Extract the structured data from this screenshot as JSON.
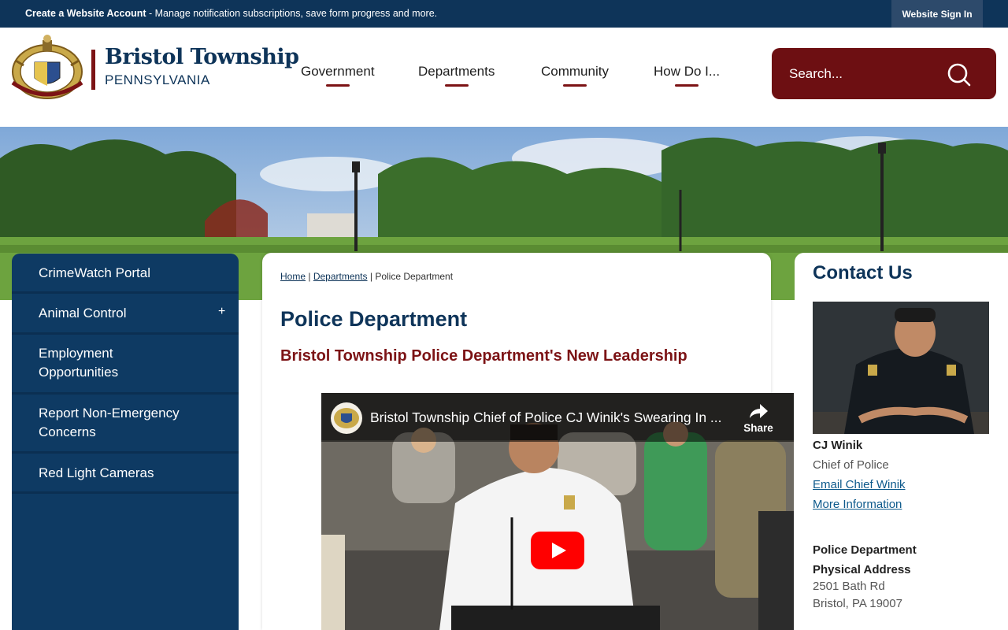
{
  "topbar": {
    "create_label": "Create a Website Account",
    "create_desc": " - Manage notification subscriptions, save form progress and more.",
    "signin_label": "Website Sign In"
  },
  "header": {
    "name": "Bristol Township",
    "state": "PENNSYLVANIA",
    "seal_icon": "township-seal-icon",
    "nav": [
      "Government",
      "Departments",
      "Community",
      "How Do I..."
    ],
    "search_placeholder": "Search...",
    "search_icon": "search-icon",
    "accent": "#7c1315",
    "brand_color": "#0e3459"
  },
  "sidebar": {
    "items": [
      {
        "label": "CrimeWatch Portal"
      },
      {
        "label": "Animal Control",
        "expand": "+"
      },
      {
        "label": "Employment Opportunities"
      },
      {
        "label": "Report Non-Emergency Concerns"
      },
      {
        "label": "Red Light Cameras"
      }
    ]
  },
  "breadcrumb": {
    "home": "Home",
    "sep": " | ",
    "departments": "Departments",
    "current": "Police Department"
  },
  "main": {
    "title": "Police Department",
    "subtitle": "Bristol Township Police Department's New Leadership"
  },
  "video": {
    "title": "Bristol Township Chief of Police CJ Winik's Swearing In ...",
    "share_label": "Share",
    "play_icon": "youtube-play-icon",
    "share_icon": "share-arrow-icon"
  },
  "contact": {
    "title": "Contact Us",
    "name": "CJ Winik",
    "role": "Chief of Police",
    "email_link": "Email Chief Winik",
    "more_link": "More Information",
    "dept": "Police Department",
    "address_label": "Physical Address",
    "street": "2501 Bath Rd",
    "city": "Bristol, PA 19007"
  }
}
